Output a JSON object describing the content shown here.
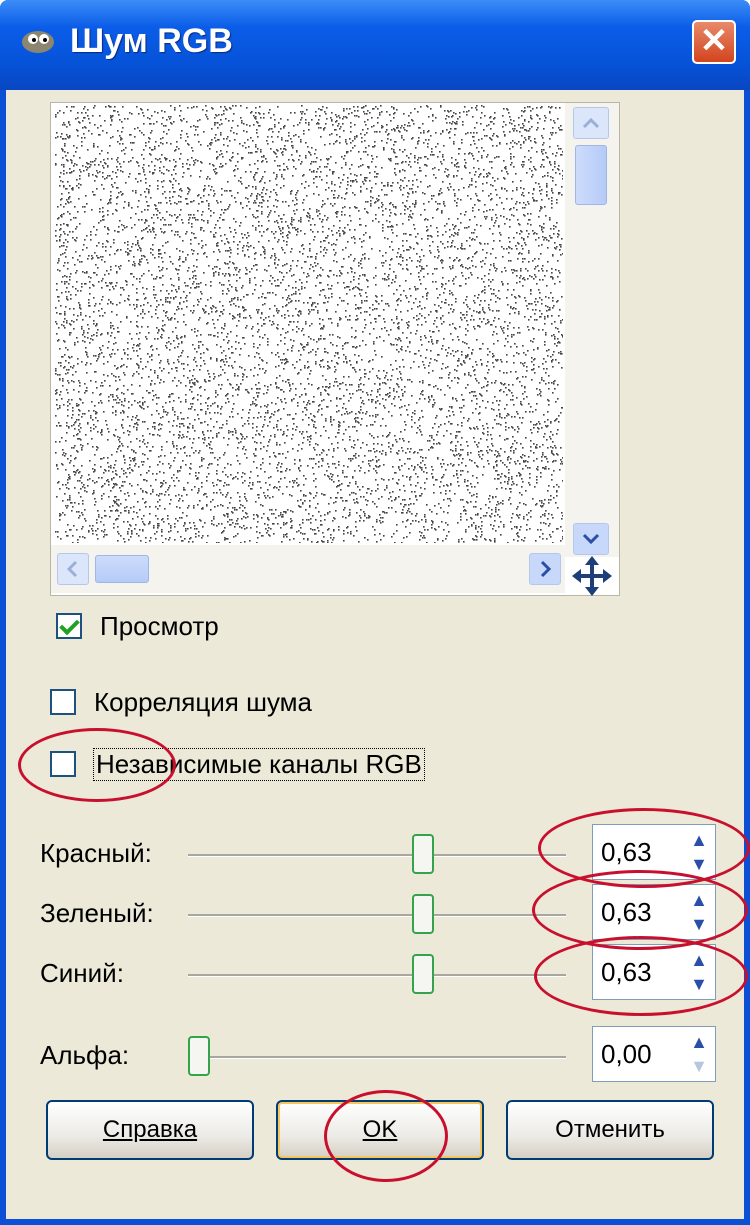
{
  "window": {
    "title": "Шум RGB",
    "close_label": "✕"
  },
  "preview": {
    "checkbox_label": "Просмотр",
    "checked": true
  },
  "options": {
    "correlated_label": "Корреляция шума",
    "independent_label": "Независимые каналы RGB"
  },
  "sliders": [
    {
      "label": "Красный:",
      "value": "0,63",
      "level": 0.63
    },
    {
      "label": "Зеленый:",
      "value": "0,63",
      "level": 0.63
    },
    {
      "label": "Синий:",
      "value": "0,63",
      "level": 0.63
    },
    {
      "label": "Альфа:",
      "value": "0,00",
      "level": 0.0
    }
  ],
  "buttons": {
    "help": "Справка",
    "ok": "OK",
    "cancel": "Отменить"
  },
  "colors": {
    "titlebar": "#0653d9",
    "annotation": "#c8102e",
    "dialog_bg": "#ece9d8"
  }
}
